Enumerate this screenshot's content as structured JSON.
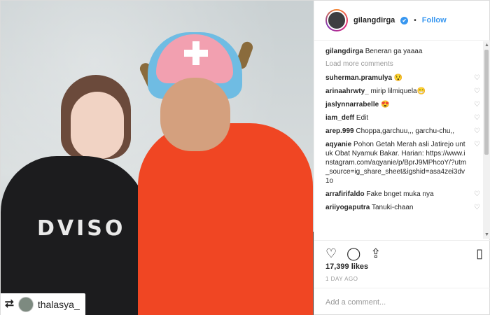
{
  "post": {
    "username": "gilangdirga",
    "follow_label": "Follow",
    "dot": "•",
    "caption_user": "gilangdirga",
    "caption_text": "Beneran ga yaaaa",
    "load_more": "Load more comments",
    "comments": [
      {
        "user": "suherman.pramulya",
        "text": "😯"
      },
      {
        "user": "arinaahrwty_",
        "text": "mirip lilmiquela😁"
      },
      {
        "user": "jaslynnarrabelle",
        "text": "😍"
      },
      {
        "user": "iam_deff",
        "text": "Edit"
      },
      {
        "user": "arep.999",
        "text": "Choppa,garchuu,,, garchu-chu,,"
      },
      {
        "user": "aqyanie",
        "text": "Pohon Getah Merah asli Jatirejo untuk Obat Nyamuk Bakar. Harian: https://www.instagram.com/aqyanie/p/BprJ9MPhcoY/?utm_source=ig_share_sheet&igshid=asa4zei3dv1o"
      },
      {
        "user": "arrafirifaldo",
        "text": "Fake bnget muka nya"
      },
      {
        "user": "ariiyogaputra",
        "text": "Tanuki-chaan"
      }
    ],
    "likes": "17,399 likes",
    "time": "1 DAY AGO",
    "add_comment_placeholder": "Add a comment..."
  },
  "photo": {
    "repost_user": "thalasya_",
    "shirt_print": "DVISO"
  },
  "icons": {
    "heart": "♡",
    "comment": "◯",
    "share": "⇪",
    "save": "▯",
    "verified": "✔",
    "repost": "⮂"
  },
  "colors": {
    "link": "#3897f0",
    "jacket": "#f04623",
    "hat": "#6fbce3"
  }
}
